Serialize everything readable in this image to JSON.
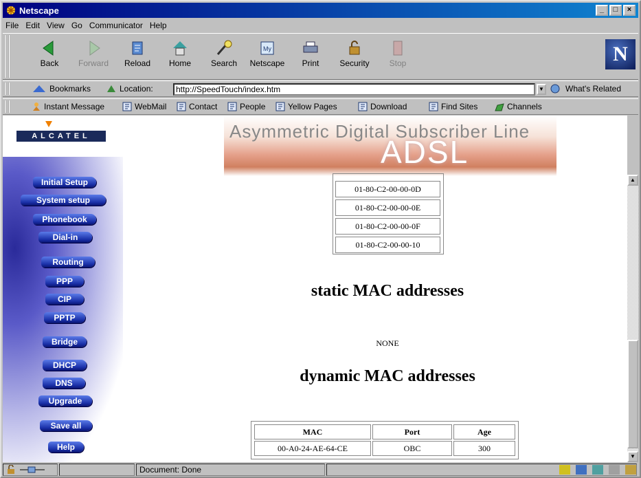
{
  "window": {
    "title": "Netscape",
    "btn_min": "_",
    "btn_max": "□",
    "btn_close": "×"
  },
  "menu": [
    "File",
    "Edit",
    "View",
    "Go",
    "Communicator",
    "Help"
  ],
  "nav": {
    "back": "Back",
    "forward": "Forward",
    "reload": "Reload",
    "home": "Home",
    "search": "Search",
    "netscape": "Netscape",
    "print": "Print",
    "security": "Security",
    "stop": "Stop",
    "logo": "N"
  },
  "location": {
    "bookmarks": "Bookmarks",
    "label": "Location:",
    "url": "http://SpeedTouch/index.htm",
    "whats_related": "What's Related"
  },
  "personal": [
    "Instant Message",
    "WebMail",
    "Contact",
    "People",
    "Yellow Pages",
    "Download",
    "Find Sites",
    "Channels"
  ],
  "brand": {
    "name": "ALCATEL"
  },
  "sidebar": [
    "Initial Setup",
    "System setup",
    "Phonebook",
    "Dial-in",
    "Routing",
    "PPP",
    "CIP",
    "PPTP",
    "Bridge",
    "DHCP",
    "DNS",
    "Upgrade",
    "Save all",
    "Help"
  ],
  "banner": {
    "line1": "Asymmetric Digital Subscriber Line",
    "line2": "ADSL"
  },
  "mac_list": [
    "01-80-C2-00-00-0D",
    "01-80-C2-00-00-0E",
    "01-80-C2-00-00-0F",
    "01-80-C2-00-00-10"
  ],
  "static_heading": "static MAC addresses",
  "static_value": "NONE",
  "dynamic_heading": "dynamic MAC addresses",
  "dynamic_table": {
    "headers": [
      "MAC",
      "Port",
      "Age"
    ],
    "rows": [
      [
        "00-A0-24-AE-64-CE",
        "OBC",
        "300"
      ]
    ]
  },
  "status": {
    "text": "Document: Done"
  },
  "colors": {
    "titlebar": "#000080",
    "sidebar_button": "#1a30a8",
    "alcatel_accent": "#f08000"
  }
}
